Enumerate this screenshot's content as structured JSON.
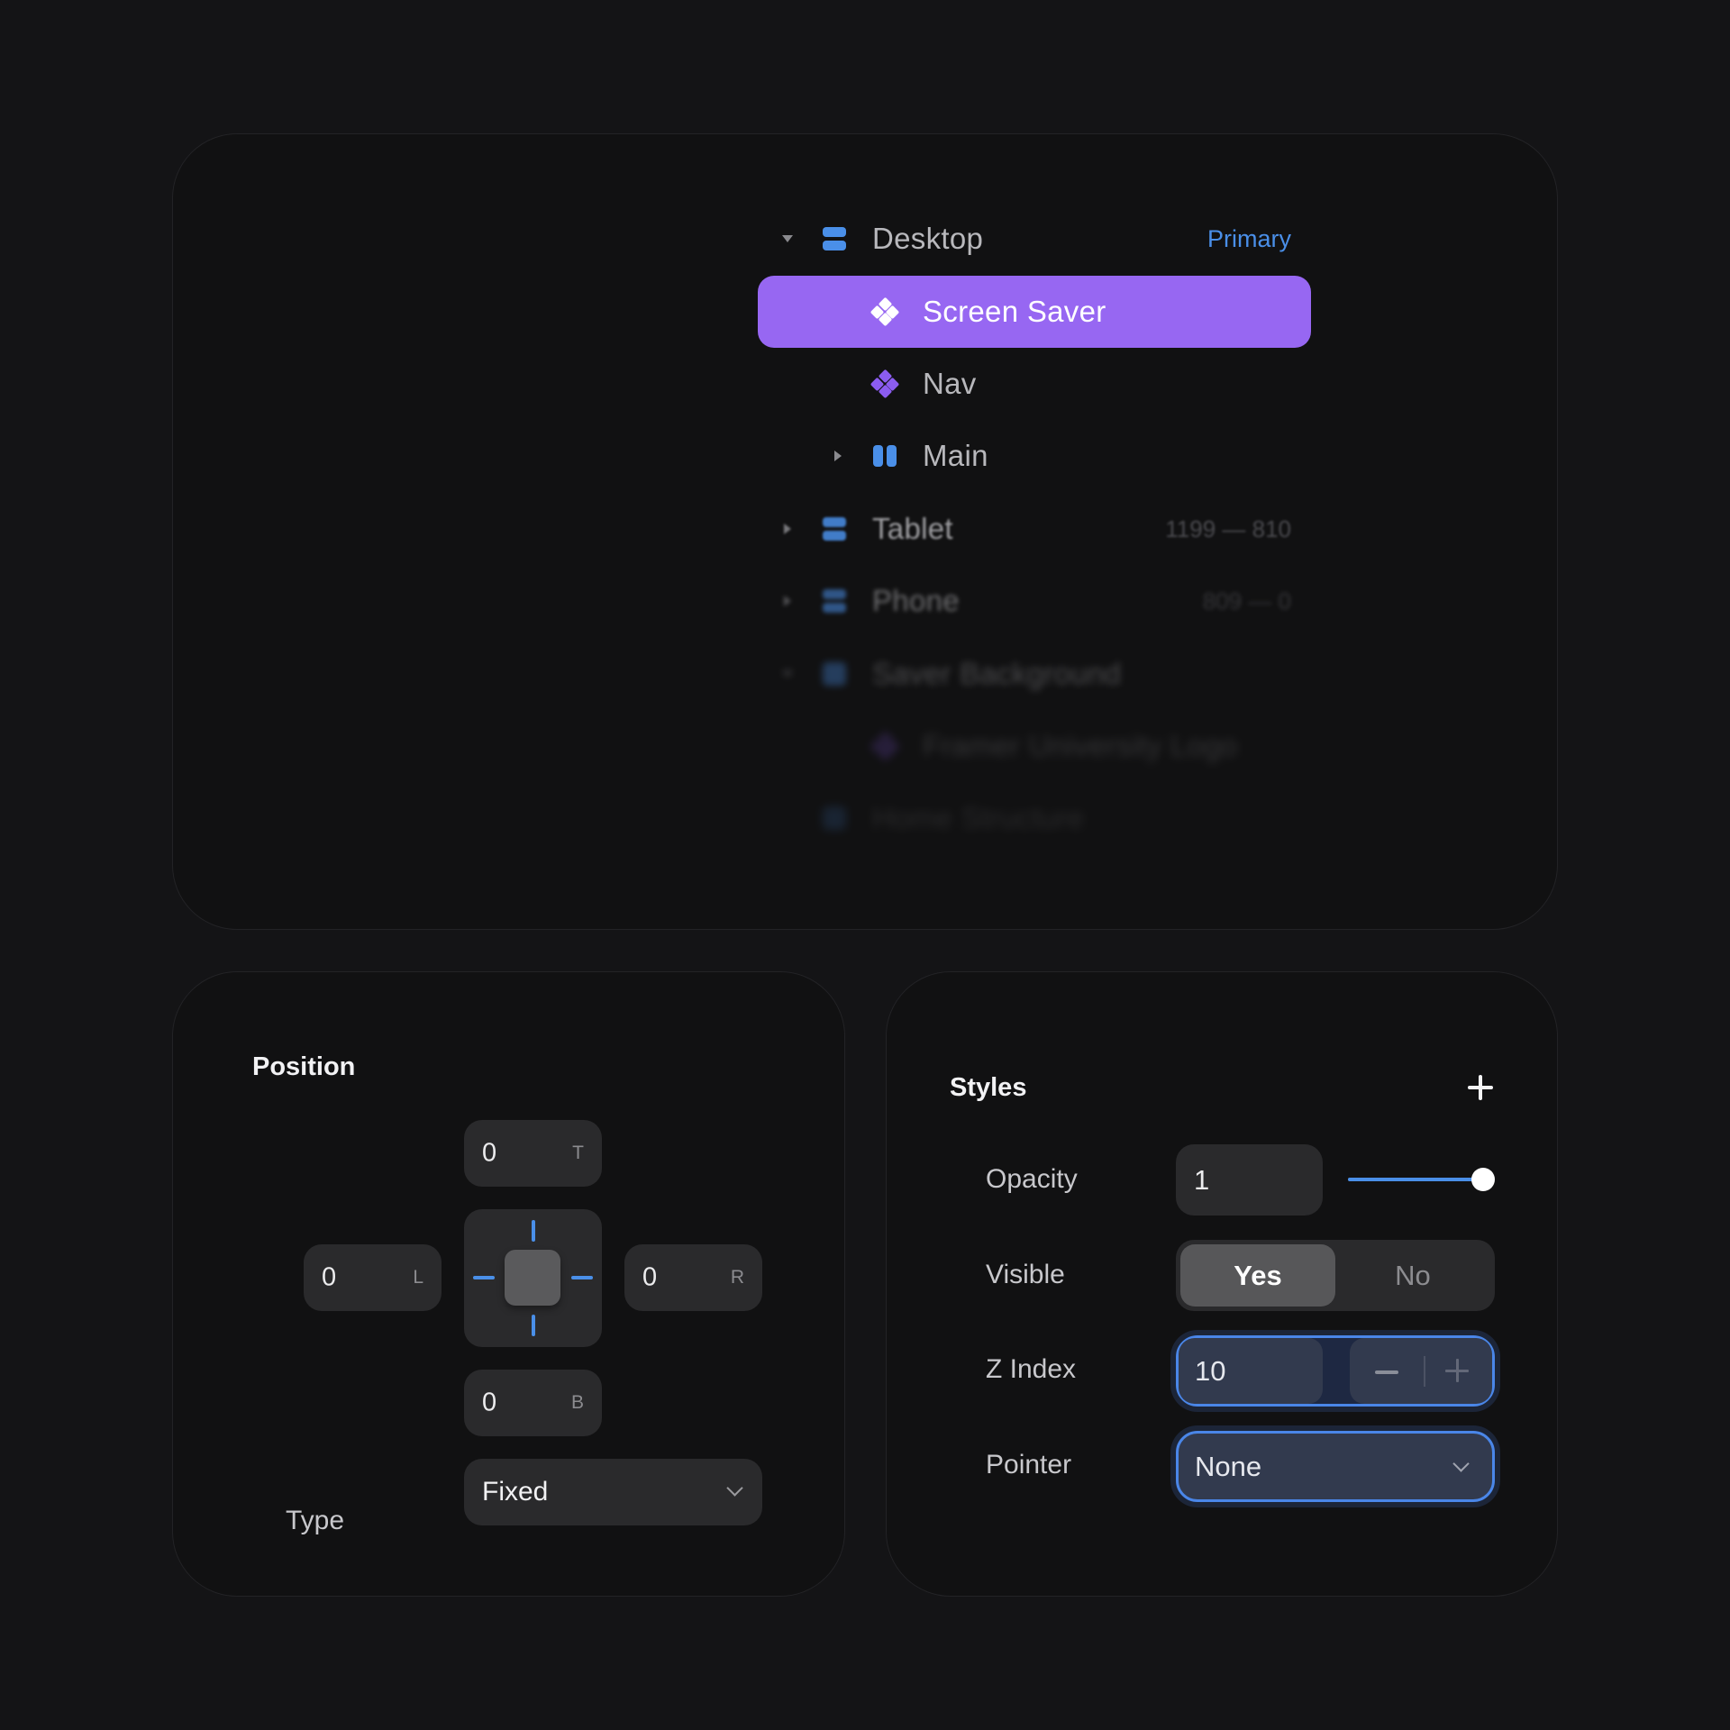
{
  "layers": {
    "items": [
      {
        "label": "Desktop",
        "meta": "Primary",
        "icon": "stack-icon",
        "expanded": true,
        "depth": 0,
        "selected": false
      },
      {
        "label": "Screen Saver",
        "meta": "",
        "icon": "component-icon",
        "expanded": null,
        "depth": 1,
        "selected": true
      },
      {
        "label": "Nav",
        "meta": "",
        "icon": "component-icon",
        "expanded": null,
        "depth": 1,
        "selected": false
      },
      {
        "label": "Main",
        "meta": "",
        "icon": "columns-icon",
        "expanded": false,
        "depth": 1,
        "selected": false
      },
      {
        "label": "Tablet",
        "meta": "1199 — 810",
        "icon": "stack-icon",
        "expanded": false,
        "depth": 0,
        "selected": false
      },
      {
        "label": "Phone",
        "meta": "809 — 0",
        "icon": "stack-icon",
        "expanded": false,
        "depth": 0,
        "selected": false
      },
      {
        "label": "Saver Background",
        "meta": "",
        "icon": "frame-icon",
        "expanded": true,
        "depth": 0,
        "selected": false
      },
      {
        "label": "Framer University Logo",
        "meta": "",
        "icon": "component-icon",
        "expanded": null,
        "depth": 1,
        "selected": false
      },
      {
        "label": "Home Structure",
        "meta": "",
        "icon": "frame-icon",
        "expanded": null,
        "depth": 0,
        "selected": false
      }
    ]
  },
  "position": {
    "title": "Position",
    "top": {
      "value": "0",
      "tag": "T"
    },
    "left": {
      "value": "0",
      "tag": "L"
    },
    "right": {
      "value": "0",
      "tag": "R"
    },
    "bottom": {
      "value": "0",
      "tag": "B"
    },
    "type_label": "Type",
    "type_value": "Fixed"
  },
  "styles": {
    "title": "Styles",
    "opacity_label": "Opacity",
    "opacity_value": "1",
    "opacity_slider_fraction": 1.0,
    "visible_label": "Visible",
    "visible_options": [
      "Yes",
      "No"
    ],
    "visible_selected": "Yes",
    "zindex_label": "Z Index",
    "zindex_value": "10",
    "pointer_label": "Pointer",
    "pointer_value": "None"
  },
  "colors": {
    "accent_blue": "#4a8fe8",
    "selection_purple": "#9767f2",
    "meta_primary": "#4a8fe8"
  }
}
